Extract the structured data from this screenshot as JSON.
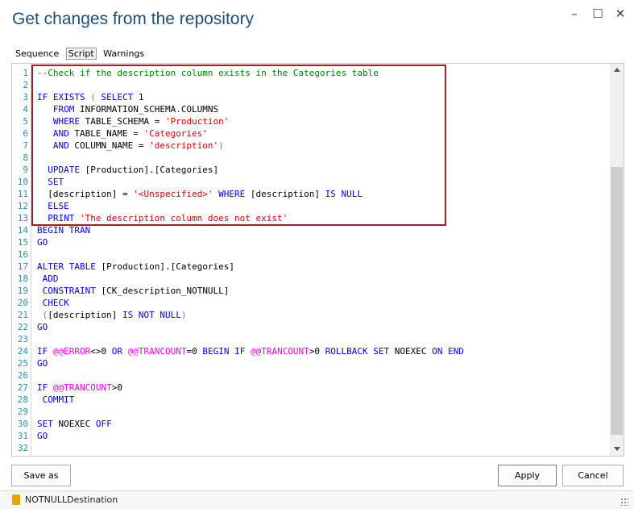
{
  "window": {
    "title": "Get changes from the repository",
    "controls": {
      "minimize": "–",
      "maximize": "☐",
      "close": "✕"
    }
  },
  "tabs": [
    {
      "label": "Sequence"
    },
    {
      "label": "Script"
    },
    {
      "label": "Warnings"
    }
  ],
  "line_numbers": [
    "1",
    "2",
    "3",
    "4",
    "5",
    "6",
    "7",
    "8",
    "9",
    "10",
    "11",
    "12",
    "13",
    "14",
    "15",
    "16",
    "17",
    "18",
    "19",
    "20",
    "21",
    "22",
    "23",
    "24",
    "25",
    "26",
    "27",
    "28",
    "29",
    "30",
    "31",
    "32"
  ],
  "code_lines": [
    [
      {
        "t": "--Check if the description column exists in the Categories table",
        "c": "cm"
      }
    ],
    [],
    [
      {
        "t": "IF ",
        "c": "kw"
      },
      {
        "t": "EXISTS ",
        "c": "kw"
      },
      {
        "t": "( ",
        "c": "gr"
      },
      {
        "t": "SELECT ",
        "c": "kw"
      },
      {
        "t": "1",
        "c": ""
      }
    ],
    [
      {
        "t": "   FROM ",
        "c": "kw"
      },
      {
        "t": "INFORMATION_SCHEMA.COLUMNS",
        "c": ""
      }
    ],
    [
      {
        "t": "   WHERE ",
        "c": "kw"
      },
      {
        "t": "TABLE_SCHEMA = ",
        "c": ""
      },
      {
        "t": "'Production'",
        "c": "str"
      }
    ],
    [
      {
        "t": "   AND ",
        "c": "kw"
      },
      {
        "t": "TABLE_NAME = ",
        "c": ""
      },
      {
        "t": "'Categories'",
        "c": "str"
      }
    ],
    [
      {
        "t": "   AND ",
        "c": "kw"
      },
      {
        "t": "COLUMN_NAME = ",
        "c": ""
      },
      {
        "t": "'description'",
        "c": "str"
      },
      {
        "t": ")",
        "c": "gr"
      }
    ],
    [],
    [
      {
        "t": "  UPDATE ",
        "c": "kw"
      },
      {
        "t": "[Production].[Categories]",
        "c": ""
      }
    ],
    [
      {
        "t": "  SET",
        "c": "kw"
      }
    ],
    [
      {
        "t": "  [description] = ",
        "c": ""
      },
      {
        "t": "'<Unspecified>'",
        "c": "str"
      },
      {
        "t": " WHERE ",
        "c": "kw"
      },
      {
        "t": "[description] ",
        "c": ""
      },
      {
        "t": "IS NULL",
        "c": "kw"
      }
    ],
    [
      {
        "t": "  ELSE",
        "c": "kw"
      }
    ],
    [
      {
        "t": "  PRINT ",
        "c": "kw"
      },
      {
        "t": "'The description column does not exist'",
        "c": "str"
      }
    ],
    [
      {
        "t": "BEGIN TRAN",
        "c": "kw"
      }
    ],
    [
      {
        "t": "GO",
        "c": "kw"
      }
    ],
    [],
    [
      {
        "t": "ALTER TABLE ",
        "c": "kw"
      },
      {
        "t": "[Production].[Categories]",
        "c": ""
      }
    ],
    [
      {
        "t": " ADD",
        "c": "kw"
      }
    ],
    [
      {
        "t": " CONSTRAINT ",
        "c": "kw"
      },
      {
        "t": "[CK_description_NOTNULL]",
        "c": ""
      }
    ],
    [
      {
        "t": " CHECK",
        "c": "kw"
      }
    ],
    [
      {
        "t": " (",
        "c": "gr"
      },
      {
        "t": "[description] ",
        "c": ""
      },
      {
        "t": "IS NOT NULL",
        "c": "kw"
      },
      {
        "t": ")",
        "c": "gr"
      }
    ],
    [
      {
        "t": "GO",
        "c": "kw"
      }
    ],
    [],
    [
      {
        "t": "IF ",
        "c": "kw"
      },
      {
        "t": "@@ERROR",
        "c": "fn"
      },
      {
        "t": "<>0 ",
        "c": ""
      },
      {
        "t": "OR ",
        "c": "kw"
      },
      {
        "t": "@@TRANCOUNT",
        "c": "fn"
      },
      {
        "t": "=0 ",
        "c": ""
      },
      {
        "t": "BEGIN IF ",
        "c": "kw"
      },
      {
        "t": "@@TRANCOUNT",
        "c": "fn"
      },
      {
        "t": ">0 ",
        "c": ""
      },
      {
        "t": "ROLLBACK SET ",
        "c": "kw"
      },
      {
        "t": "NOEXEC ",
        "c": ""
      },
      {
        "t": "ON END",
        "c": "kw"
      }
    ],
    [
      {
        "t": "GO",
        "c": "kw"
      }
    ],
    [],
    [
      {
        "t": "IF ",
        "c": "kw"
      },
      {
        "t": "@@TRANCOUNT",
        "c": "fn"
      },
      {
        "t": ">0",
        "c": ""
      }
    ],
    [
      {
        "t": " COMMIT",
        "c": "kw"
      }
    ],
    [],
    [
      {
        "t": "SET ",
        "c": "kw"
      },
      {
        "t": "NOEXEC ",
        "c": ""
      },
      {
        "t": "OFF",
        "c": "kw"
      }
    ],
    [
      {
        "t": "GO",
        "c": "kw"
      }
    ],
    []
  ],
  "buttons": {
    "save_as": "Save as",
    "apply": "Apply",
    "cancel": "Cancel"
  },
  "status_bar": {
    "connection": "NOTNULLDestination",
    "icon": "database-icon"
  },
  "colors": {
    "title": "#1e4e79",
    "keyword": "#0000ff",
    "string": "#e00000",
    "comment": "#008000",
    "function": "#ff00ff",
    "highlight_border": "#a0202a"
  }
}
